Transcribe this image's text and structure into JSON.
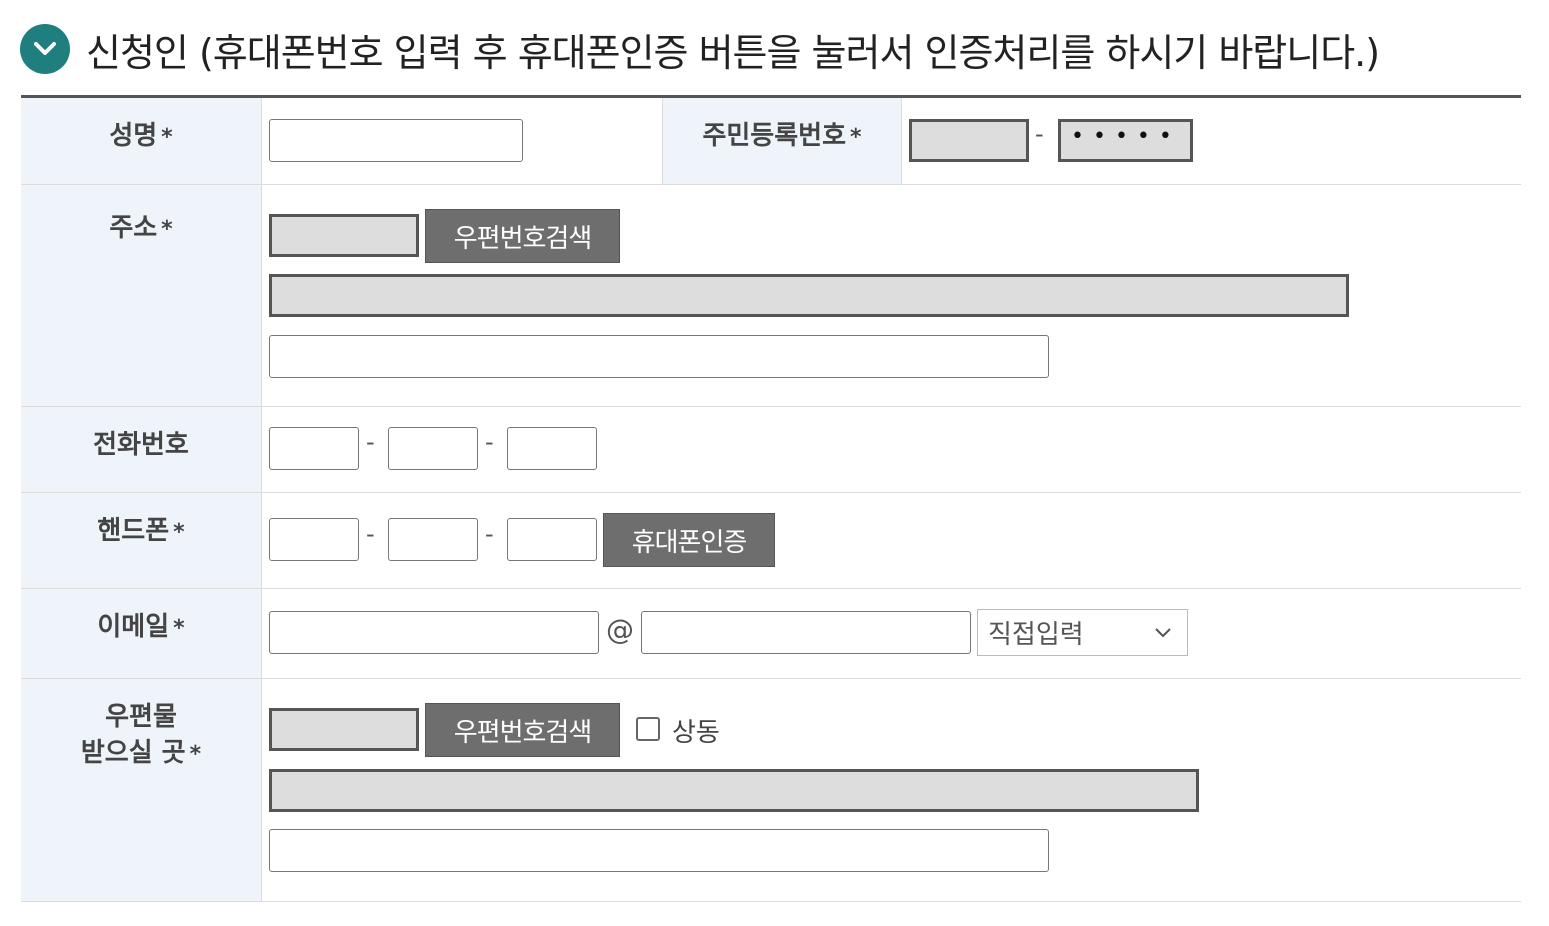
{
  "header": {
    "title": "신청인 (휴대폰번호 입력 후 휴대폰인증 버튼을 눌러서 인증처리를 하시기 바랍니다.)"
  },
  "required_mark": "*",
  "form": {
    "name": {
      "label": "성명",
      "value": ""
    },
    "resident_number": {
      "label": "주민등록번호",
      "front": "",
      "dash": "-",
      "back_masked": "•••••"
    },
    "address": {
      "label": "주소",
      "zip": "",
      "search_button": "우편번호검색",
      "address1": "",
      "address2": ""
    },
    "phone": {
      "label": "전화번호",
      "part1": "",
      "part2": "",
      "part3": "",
      "dash": "-"
    },
    "mobile": {
      "label": "핸드폰",
      "part1": "",
      "part2": "",
      "part3": "",
      "dash": "-",
      "verify_button": "휴대폰인증"
    },
    "email": {
      "label": "이메일",
      "local": "",
      "at": "@",
      "domain": "",
      "domain_select": "직접입력"
    },
    "mail_address": {
      "label_line1": "우편물",
      "label_line2": "받으실 곳",
      "zip": "",
      "search_button": "우편번호검색",
      "same_checkbox_label": "상동",
      "same_checked": false,
      "address1": "",
      "address2": ""
    }
  },
  "colors": {
    "header_icon": "#1f7f7f",
    "label_bg": "#eef4f9",
    "button_bg": "#6e6e6e",
    "readonly_bg": "#dddddd"
  }
}
